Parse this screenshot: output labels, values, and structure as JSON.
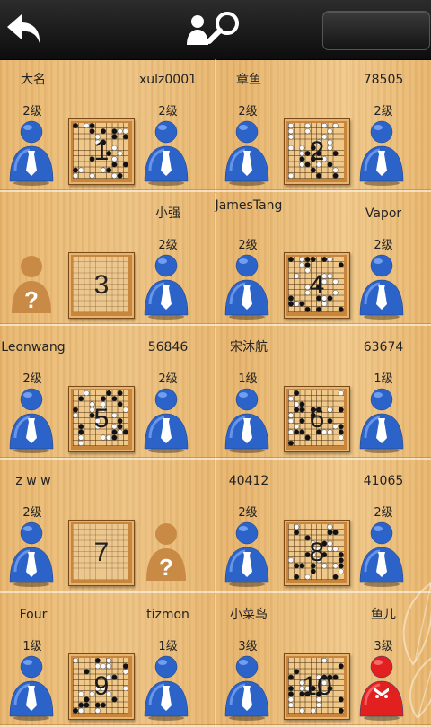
{
  "header": {
    "back_icon": "back-arrow-icon",
    "search_icon": "user-search-icon",
    "menu_icon": "menu-button"
  },
  "rows": [
    {
      "tables": [
        {
          "number": "1",
          "has_game": true,
          "left": {
            "name": "大名",
            "rank": "2级",
            "avatar": "male"
          },
          "right": {
            "name": "xulz0001",
            "rank": "2级",
            "avatar": "male"
          }
        },
        {
          "number": "2",
          "has_game": true,
          "left": {
            "name": "章鱼",
            "rank": "2级",
            "avatar": "male"
          },
          "right": {
            "name": "78505",
            "rank": "2级",
            "avatar": "male"
          }
        }
      ]
    },
    {
      "tables": [
        {
          "number": "3",
          "has_game": false,
          "left": {
            "name": "",
            "rank": "",
            "avatar": "unknown"
          },
          "right": {
            "name": "小强",
            "rank": "2级",
            "avatar": "male"
          }
        },
        {
          "number": "4",
          "has_game": true,
          "left": {
            "name": "JamesTang",
            "rank": "2级",
            "avatar": "male"
          },
          "right": {
            "name": "Vapor",
            "rank": "2级",
            "avatar": "male"
          }
        }
      ]
    },
    {
      "tables": [
        {
          "number": "5",
          "has_game": true,
          "left": {
            "name": "Leonwang",
            "rank": "2级",
            "avatar": "male"
          },
          "right": {
            "name": "56846",
            "rank": "2级",
            "avatar": "male"
          }
        },
        {
          "number": "6",
          "has_game": true,
          "left": {
            "name": "宋沐航",
            "rank": "1级",
            "avatar": "male"
          },
          "right": {
            "name": "63674",
            "rank": "1级",
            "avatar": "male"
          }
        }
      ]
    },
    {
      "tables": [
        {
          "number": "7",
          "has_game": false,
          "left": {
            "name": "z w w",
            "rank": "2级",
            "avatar": "male"
          },
          "right": {
            "name": "",
            "rank": "",
            "avatar": "unknown"
          }
        },
        {
          "number": "8",
          "has_game": true,
          "left": {
            "name": "40412",
            "rank": "2级",
            "avatar": "male"
          },
          "right": {
            "name": "41065",
            "rank": "2级",
            "avatar": "male"
          }
        }
      ]
    },
    {
      "tables": [
        {
          "number": "9",
          "has_game": true,
          "left": {
            "name": "Four",
            "rank": "1级",
            "avatar": "male"
          },
          "right": {
            "name": "tizmon",
            "rank": "1级",
            "avatar": "male"
          }
        },
        {
          "number": "10",
          "has_game": true,
          "left": {
            "name": "小菜鸟",
            "rank": "3级",
            "avatar": "male"
          },
          "right": {
            "name": "鱼儿",
            "rank": "3级",
            "avatar": "female"
          }
        }
      ]
    }
  ],
  "colors": {
    "header_bg": "#141414",
    "male_avatar": "#2c63c8",
    "female_avatar": "#e22020",
    "unknown_avatar": "#c98a45"
  }
}
